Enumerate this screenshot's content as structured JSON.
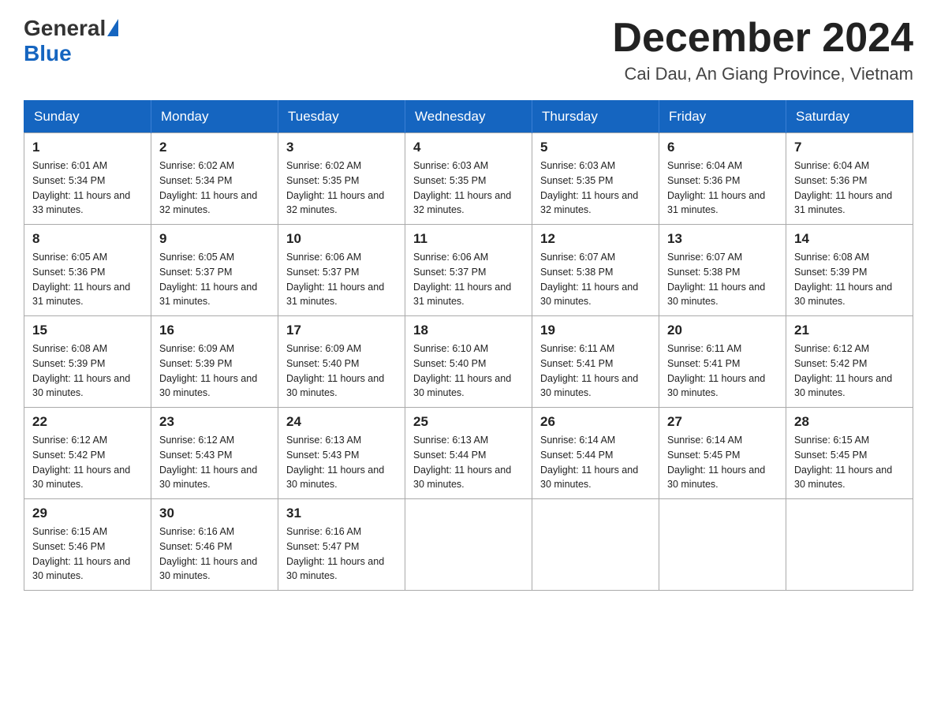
{
  "header": {
    "logo": {
      "general": "General",
      "blue": "Blue"
    },
    "title": "December 2024",
    "location": "Cai Dau, An Giang Province, Vietnam"
  },
  "days_of_week": [
    "Sunday",
    "Monday",
    "Tuesday",
    "Wednesday",
    "Thursday",
    "Friday",
    "Saturday"
  ],
  "weeks": [
    [
      {
        "day": "1",
        "sunrise": "6:01 AM",
        "sunset": "5:34 PM",
        "daylight": "11 hours and 33 minutes."
      },
      {
        "day": "2",
        "sunrise": "6:02 AM",
        "sunset": "5:34 PM",
        "daylight": "11 hours and 32 minutes."
      },
      {
        "day": "3",
        "sunrise": "6:02 AM",
        "sunset": "5:35 PM",
        "daylight": "11 hours and 32 minutes."
      },
      {
        "day": "4",
        "sunrise": "6:03 AM",
        "sunset": "5:35 PM",
        "daylight": "11 hours and 32 minutes."
      },
      {
        "day": "5",
        "sunrise": "6:03 AM",
        "sunset": "5:35 PM",
        "daylight": "11 hours and 32 minutes."
      },
      {
        "day": "6",
        "sunrise": "6:04 AM",
        "sunset": "5:36 PM",
        "daylight": "11 hours and 31 minutes."
      },
      {
        "day": "7",
        "sunrise": "6:04 AM",
        "sunset": "5:36 PM",
        "daylight": "11 hours and 31 minutes."
      }
    ],
    [
      {
        "day": "8",
        "sunrise": "6:05 AM",
        "sunset": "5:36 PM",
        "daylight": "11 hours and 31 minutes."
      },
      {
        "day": "9",
        "sunrise": "6:05 AM",
        "sunset": "5:37 PM",
        "daylight": "11 hours and 31 minutes."
      },
      {
        "day": "10",
        "sunrise": "6:06 AM",
        "sunset": "5:37 PM",
        "daylight": "11 hours and 31 minutes."
      },
      {
        "day": "11",
        "sunrise": "6:06 AM",
        "sunset": "5:37 PM",
        "daylight": "11 hours and 31 minutes."
      },
      {
        "day": "12",
        "sunrise": "6:07 AM",
        "sunset": "5:38 PM",
        "daylight": "11 hours and 30 minutes."
      },
      {
        "day": "13",
        "sunrise": "6:07 AM",
        "sunset": "5:38 PM",
        "daylight": "11 hours and 30 minutes."
      },
      {
        "day": "14",
        "sunrise": "6:08 AM",
        "sunset": "5:39 PM",
        "daylight": "11 hours and 30 minutes."
      }
    ],
    [
      {
        "day": "15",
        "sunrise": "6:08 AM",
        "sunset": "5:39 PM",
        "daylight": "11 hours and 30 minutes."
      },
      {
        "day": "16",
        "sunrise": "6:09 AM",
        "sunset": "5:39 PM",
        "daylight": "11 hours and 30 minutes."
      },
      {
        "day": "17",
        "sunrise": "6:09 AM",
        "sunset": "5:40 PM",
        "daylight": "11 hours and 30 minutes."
      },
      {
        "day": "18",
        "sunrise": "6:10 AM",
        "sunset": "5:40 PM",
        "daylight": "11 hours and 30 minutes."
      },
      {
        "day": "19",
        "sunrise": "6:11 AM",
        "sunset": "5:41 PM",
        "daylight": "11 hours and 30 minutes."
      },
      {
        "day": "20",
        "sunrise": "6:11 AM",
        "sunset": "5:41 PM",
        "daylight": "11 hours and 30 minutes."
      },
      {
        "day": "21",
        "sunrise": "6:12 AM",
        "sunset": "5:42 PM",
        "daylight": "11 hours and 30 minutes."
      }
    ],
    [
      {
        "day": "22",
        "sunrise": "6:12 AM",
        "sunset": "5:42 PM",
        "daylight": "11 hours and 30 minutes."
      },
      {
        "day": "23",
        "sunrise": "6:12 AM",
        "sunset": "5:43 PM",
        "daylight": "11 hours and 30 minutes."
      },
      {
        "day": "24",
        "sunrise": "6:13 AM",
        "sunset": "5:43 PM",
        "daylight": "11 hours and 30 minutes."
      },
      {
        "day": "25",
        "sunrise": "6:13 AM",
        "sunset": "5:44 PM",
        "daylight": "11 hours and 30 minutes."
      },
      {
        "day": "26",
        "sunrise": "6:14 AM",
        "sunset": "5:44 PM",
        "daylight": "11 hours and 30 minutes."
      },
      {
        "day": "27",
        "sunrise": "6:14 AM",
        "sunset": "5:45 PM",
        "daylight": "11 hours and 30 minutes."
      },
      {
        "day": "28",
        "sunrise": "6:15 AM",
        "sunset": "5:45 PM",
        "daylight": "11 hours and 30 minutes."
      }
    ],
    [
      {
        "day": "29",
        "sunrise": "6:15 AM",
        "sunset": "5:46 PM",
        "daylight": "11 hours and 30 minutes."
      },
      {
        "day": "30",
        "sunrise": "6:16 AM",
        "sunset": "5:46 PM",
        "daylight": "11 hours and 30 minutes."
      },
      {
        "day": "31",
        "sunrise": "6:16 AM",
        "sunset": "5:47 PM",
        "daylight": "11 hours and 30 minutes."
      },
      null,
      null,
      null,
      null
    ]
  ]
}
